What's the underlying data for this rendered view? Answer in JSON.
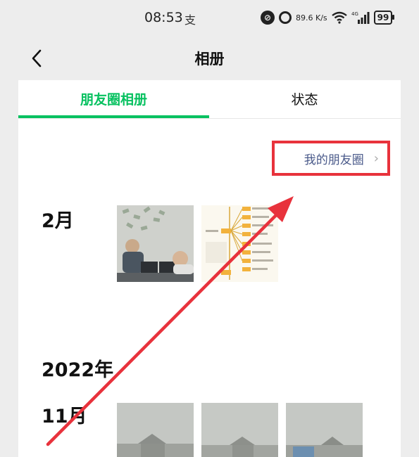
{
  "status_bar": {
    "time": "08:53",
    "alipay_glyph": "支",
    "net_speed_value": "89.6",
    "net_speed_unit": "K/s",
    "signal_label": "4G",
    "battery": "99"
  },
  "nav": {
    "title": "相册",
    "back_icon": "chevron-left-icon"
  },
  "tabs": [
    {
      "label": "朋友圈相册",
      "active": true
    },
    {
      "label": "状态",
      "active": false
    }
  ],
  "my_moments_link": {
    "label": "我的朋友圈",
    "icon": "chevron-right-icon"
  },
  "timeline": {
    "section_feb": {
      "month": "2月",
      "photos": [
        "laptop-office-workers",
        "yellow-mind-map"
      ]
    },
    "year": "2022年",
    "section_nov": {
      "month": "11月",
      "photos": [
        "foggy-rooftop-1",
        "foggy-rooftop-2",
        "foggy-rooftop-3"
      ]
    }
  },
  "colors": {
    "accent_green": "#07c160",
    "annotation_red": "#e8323c",
    "link_blue": "#4a5a8a",
    "background": "#ededed"
  }
}
